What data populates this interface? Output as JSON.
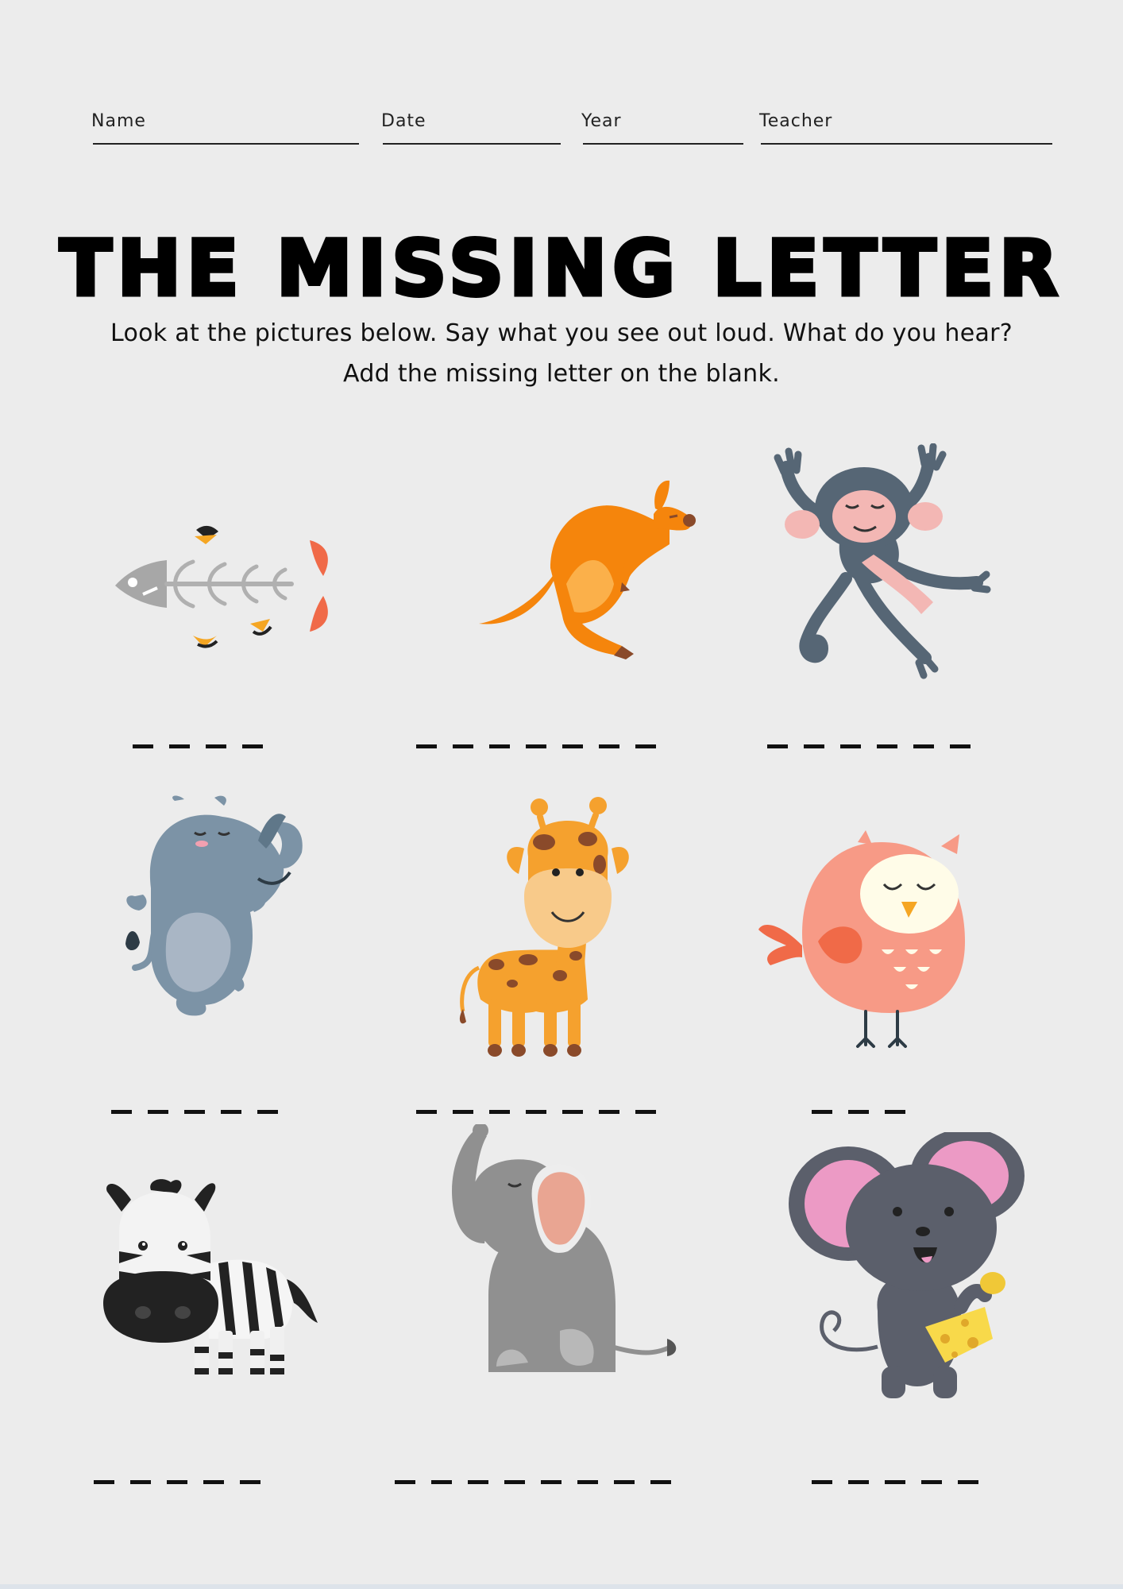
{
  "header": {
    "fields": [
      {
        "label": "Name"
      },
      {
        "label": "Date"
      },
      {
        "label": "Year"
      },
      {
        "label": "Teacher"
      }
    ]
  },
  "title": "THE MISSING LETTER",
  "instructions": [
    "Look at the pictures below. Say what you see out loud. What do you hear?",
    "Add the missing letter on the blank."
  ],
  "pictures": [
    {
      "icon": "fish-bones-icon",
      "blanks": 4
    },
    {
      "icon": "kangaroo-icon",
      "blanks": 7
    },
    {
      "icon": "monkey-icon",
      "blanks": 6
    },
    {
      "icon": "rhino-icon",
      "blanks": 5
    },
    {
      "icon": "giraffe-icon",
      "blanks": 7
    },
    {
      "icon": "owl-icon",
      "blanks": 3
    },
    {
      "icon": "zebra-icon",
      "blanks": 5
    },
    {
      "icon": "elephant-icon",
      "blanks": 8
    },
    {
      "icon": "mouse-icon",
      "blanks": 5
    }
  ],
  "colors": {
    "background": "#ececec",
    "kangaroo": "#f5850c",
    "monkey": "#566675",
    "rhino": "#7c93a6",
    "giraffe": "#f5a12e",
    "owl": "#f79a86",
    "elephant": "#909090",
    "mouse": "#5b5f6b"
  }
}
